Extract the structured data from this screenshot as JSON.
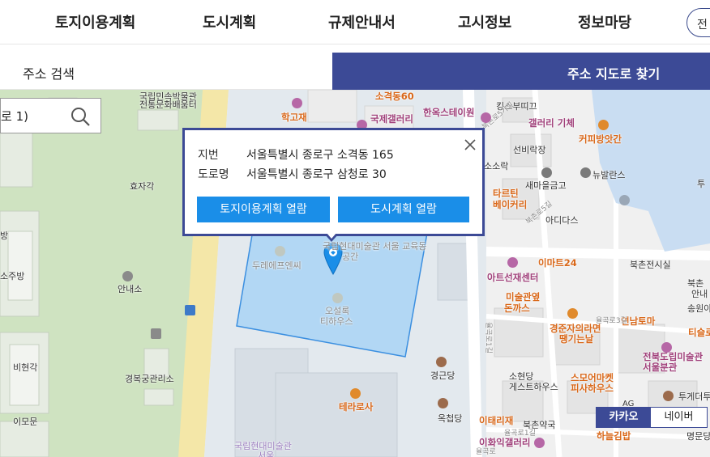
{
  "nav": {
    "items": [
      "토지이용계획",
      "도시계획",
      "규제안내서",
      "고시정보",
      "정보마당"
    ],
    "pill_label": "전"
  },
  "tabs": {
    "search": "주소 검색",
    "map": "주소 지도로 찾기"
  },
  "search": {
    "value": "로 1)"
  },
  "popup": {
    "jibun_label": "지번",
    "jibun_value": "서울특별시 종로구 소격동 165",
    "road_label": "도로명",
    "road_value": "서울특별시 종로구 삼청로 30",
    "btn_land": "토지이용계획 열람",
    "btn_city": "도시계획 열람"
  },
  "map_toggle": {
    "kakao": "카카오",
    "naver": "네이버"
  },
  "map_labels": {
    "l1": "국립민속박물관",
    "l2": "전통문화배움터",
    "l3": "학고재",
    "l4": "소격동60",
    "l5": "국제갤러리",
    "l6": "한옥스테이원",
    "l7": "킹스부띠끄",
    "l8": "갤러리 기체",
    "l9": "커피방앗간",
    "l10": "선비락장",
    "l11": "뉴발란스",
    "l12": "새마을금고",
    "l13": "타르틴",
    "l14": "베이커리",
    "l15": "아디다스",
    "l16": "효자각",
    "l17": "두레에프엔씨",
    "l18": "국립현대미술관 서울 교육동",
    "l19": "공간",
    "l20": "오설록",
    "l21": "티하우스",
    "l22": "안내소",
    "l23": "이마트24",
    "l24": "아트선재센터",
    "l25": "북촌전시실",
    "l26": "미술관옆",
    "l27": "돈까스",
    "l28": "경준자의라면",
    "l29": "땡기는날",
    "l30": "연남토마",
    "l31": "티슬로",
    "l32": "비현각",
    "l33": "경복궁관리소",
    "l34": "경근당",
    "l35": "소현당",
    "l36": "게스트하우스",
    "l37": "스모어마켓",
    "l38": "피사하우스",
    "l39": "전북도립미술관",
    "l40": "서울분관",
    "l41": "이모문",
    "l42": "테라로사",
    "l43": "옥첩당",
    "l44": "이태리재",
    "l45": "북촌약국",
    "l46": "이화익갤러리",
    "l47": "하늘김밥",
    "l48": "투게더투",
    "l49": "명문당",
    "l50": "국립현대미술관",
    "l51": "서울",
    "l52": "소주방",
    "l53": "방",
    "l54": "소소락",
    "l55": "북촌",
    "l56": "안내",
    "l57": "송원아",
    "l58": "율곡로1길",
    "l59": "북촌로5길",
    "l60": "율곡로3길",
    "l61": "율곡로1길",
    "l62": "북촌로5가길",
    "l63": "율곡로",
    "l64": "AG",
    "l65": "투"
  },
  "colors": {
    "accent": "#3c4a96",
    "button_blue": "#1a8ee8",
    "parcel_fill": "#a9d4f5",
    "parcel_stroke": "#3b8fe0"
  }
}
